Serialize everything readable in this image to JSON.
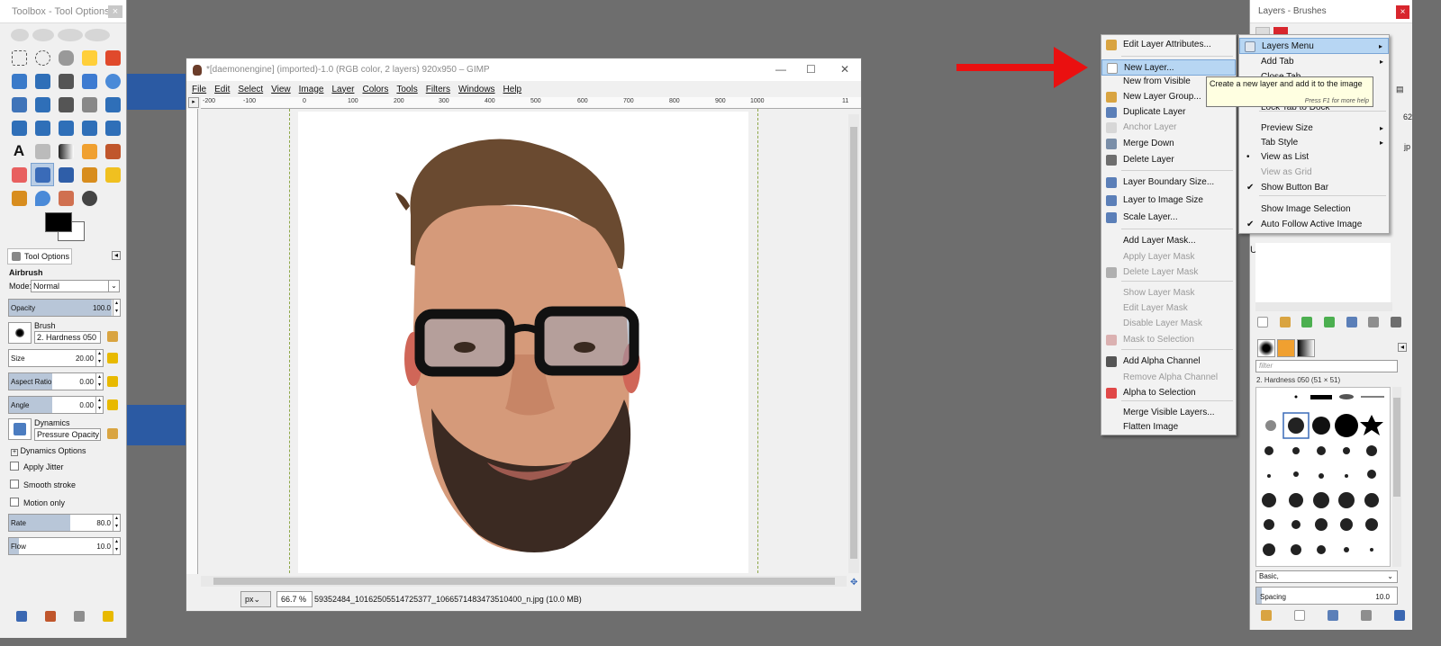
{
  "toolbox": {
    "title": "Toolbox - Tool Options",
    "close": "×",
    "tool_options_tab": "Tool Options",
    "tool_name": "Airbrush",
    "mode_label": "Mode:",
    "mode_value": "Normal",
    "opacity_label": "Opacity",
    "opacity_value": "100.0",
    "opacity_fraction": 1.0,
    "brush_label": "Brush",
    "brush_value": "2. Hardness 050",
    "size_label": "Size",
    "size_value": "20.00",
    "aspect_label": "Aspect Ratio",
    "aspect_value": "0.00",
    "angle_label": "Angle",
    "angle_value": "0.00",
    "dynamics_label": "Dynamics",
    "dynamics_value": "Pressure Opacity",
    "dynamics_options": "Dynamics Options",
    "apply_jitter": "Apply Jitter",
    "smooth_stroke": "Smooth stroke",
    "motion_only": "Motion only",
    "rate_label": "Rate",
    "rate_value": "80.0",
    "rate_fraction": 0.8,
    "flow_label": "Flow",
    "flow_value": "10.0",
    "flow_fraction": 0.1
  },
  "image_window": {
    "title": "*[daemonengine] (imported)-1.0 (RGB color, 2 layers) 920x950 – GIMP",
    "menu": [
      "File",
      "Edit",
      "Select",
      "View",
      "Image",
      "Layer",
      "Colors",
      "Tools",
      "Filters",
      "Windows",
      "Help"
    ],
    "ruler_ticks": [
      "-200",
      "-100",
      "0",
      "100",
      "200",
      "300",
      "400",
      "500",
      "600",
      "700",
      "800",
      "900",
      "1000",
      "11"
    ],
    "unit": "px",
    "zoom": "66.7 %",
    "status_file": "59352484_10162505514725377_1066571483473510400_n.jpg (10.0 MB)"
  },
  "layer_menu": {
    "items": [
      {
        "label": "Edit Layer Attributes...",
        "icon": "edit-icon",
        "disabled": false
      },
      {
        "label": "New Layer...",
        "icon": "new-layer-icon",
        "disabled": false,
        "highlighted": true
      },
      {
        "label": "New from Visible",
        "icon": "",
        "disabled": false
      },
      {
        "label": "New Layer Group...",
        "icon": "folder-icon",
        "disabled": false
      },
      {
        "label": "Duplicate Layer",
        "icon": "duplicate-icon",
        "disabled": false
      },
      {
        "label": "Anchor Layer",
        "icon": "anchor-icon",
        "disabled": true
      },
      {
        "label": "Merge Down",
        "icon": "merge-icon",
        "disabled": false
      },
      {
        "label": "Delete Layer",
        "icon": "trash-icon",
        "disabled": false
      },
      {
        "label": "Layer Boundary Size...",
        "icon": "boundary-icon",
        "disabled": false
      },
      {
        "label": "Layer to Image Size",
        "icon": "resize-icon",
        "disabled": false
      },
      {
        "label": "Scale Layer...",
        "icon": "scale-icon",
        "disabled": false
      },
      {
        "label": "Add Layer Mask...",
        "icon": "",
        "disabled": false
      },
      {
        "label": "Apply Layer Mask",
        "icon": "",
        "disabled": true
      },
      {
        "label": "Delete Layer Mask",
        "icon": "trash-icon",
        "disabled": true
      },
      {
        "label": "Show Layer Mask",
        "icon": "",
        "disabled": true
      },
      {
        "label": "Edit Layer Mask",
        "icon": "",
        "disabled": true
      },
      {
        "label": "Disable Layer Mask",
        "icon": "",
        "disabled": true
      },
      {
        "label": "Mask to Selection",
        "icon": "mask-icon",
        "disabled": true
      },
      {
        "label": "Add Alpha Channel",
        "icon": "checker-icon",
        "disabled": false
      },
      {
        "label": "Remove Alpha Channel",
        "icon": "",
        "disabled": true
      },
      {
        "label": "Alpha to Selection",
        "icon": "alpha-icon",
        "disabled": false
      },
      {
        "label": "Merge Visible Layers...",
        "icon": "",
        "disabled": false
      },
      {
        "label": "Flatten Image",
        "icon": "",
        "disabled": false
      }
    ]
  },
  "tooltip": {
    "text": "Create a new layer and add it to the image",
    "hint": "Press F1 for more help"
  },
  "layers_menu": {
    "items": [
      {
        "label": "Layers Menu",
        "highlighted": true,
        "submenu": true
      },
      {
        "label": "Add Tab",
        "submenu": true
      },
      {
        "label": "Close Tab"
      },
      {
        "label": "Lock Tab to Dock"
      },
      {
        "label": "Preview Size",
        "submenu": true
      },
      {
        "label": "Tab Style",
        "submenu": true
      },
      {
        "label": "View as List",
        "mark": "•"
      },
      {
        "label": "View as Grid",
        "disabled": true
      },
      {
        "label": "Show Button Bar",
        "mark": "✔"
      },
      {
        "label": "Show Image Selection"
      },
      {
        "label": "Auto Follow Active Image",
        "mark": "✔"
      }
    ]
  },
  "dock": {
    "title": "Layers - Brushes",
    "close": "×",
    "filter_placeholder": "filter",
    "brush_name": "2. Hardness 050 (51 × 51)",
    "tag_value": "Basic,",
    "spacing_label": "Spacing",
    "spacing_value": "10.0"
  }
}
